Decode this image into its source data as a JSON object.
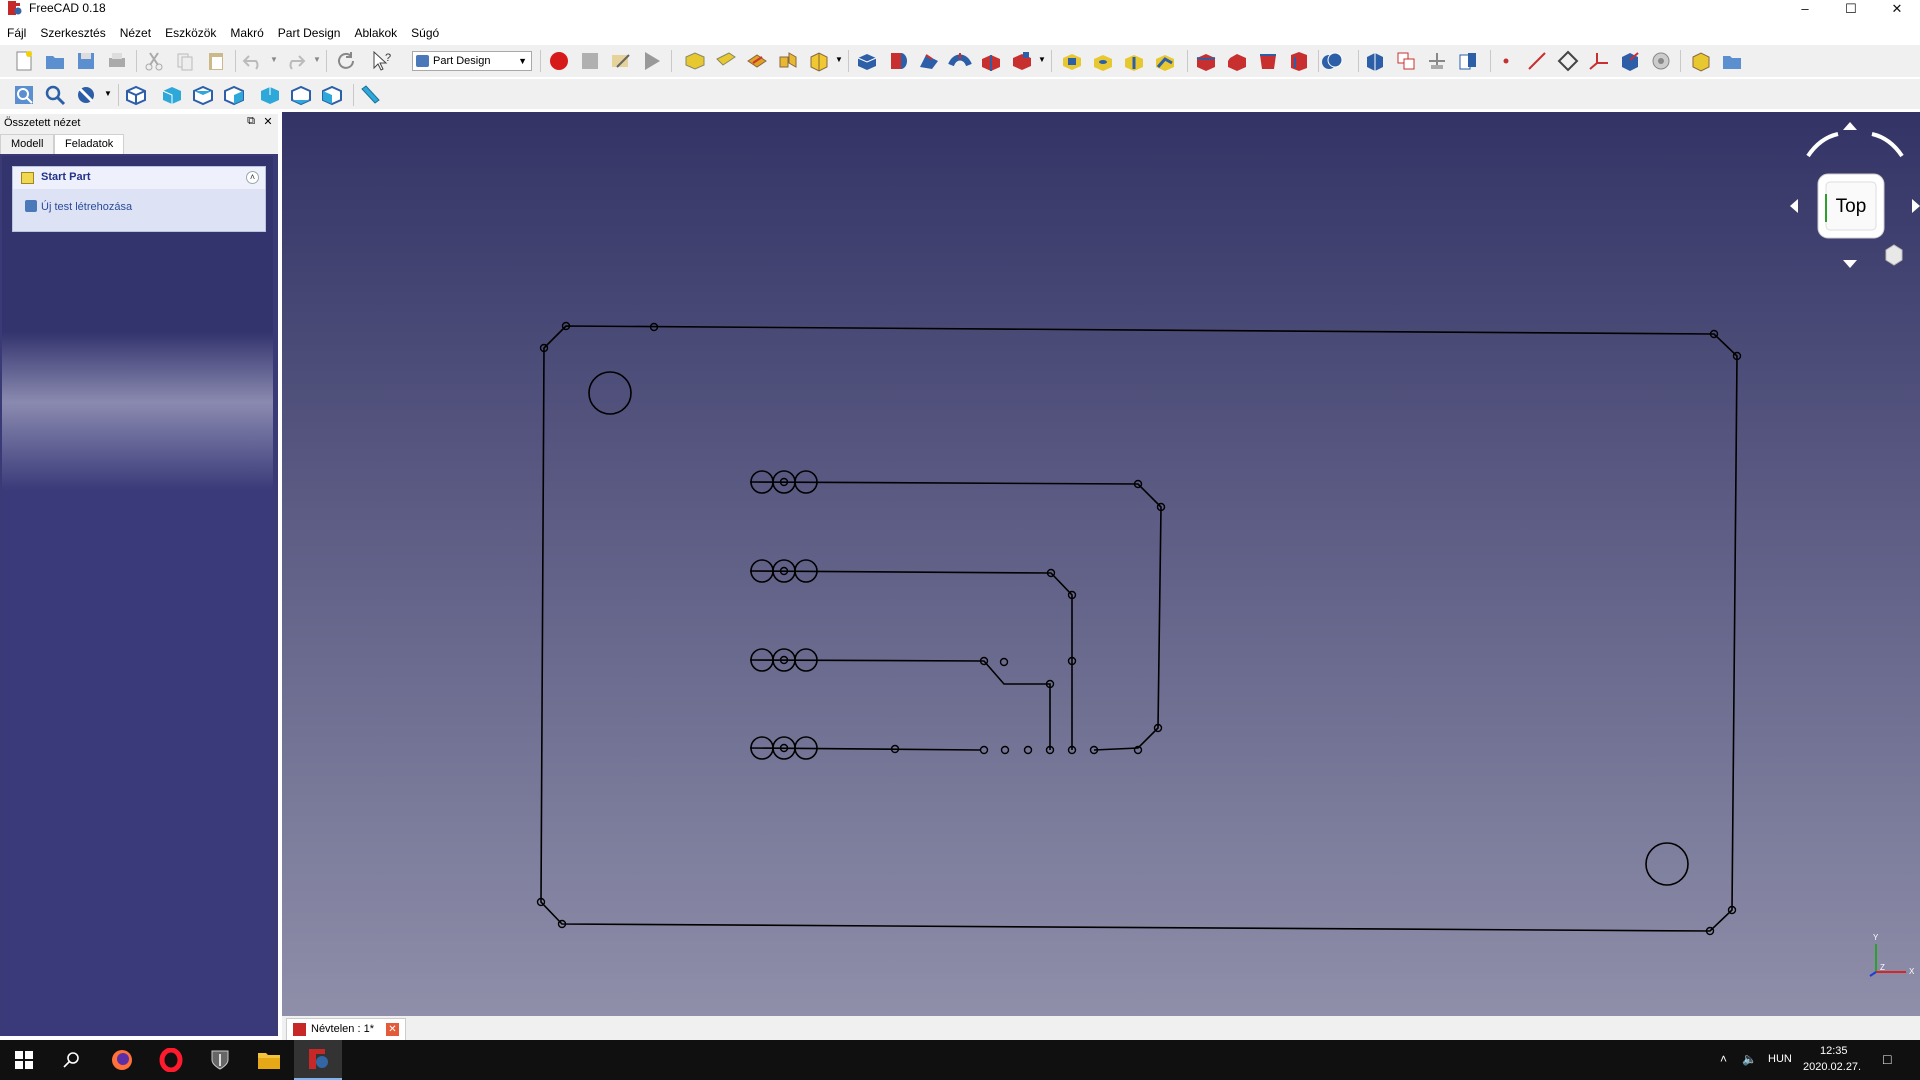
{
  "window": {
    "title": "FreeCAD 0.18"
  },
  "menu": [
    "Fájl",
    "Szerkesztés",
    "Nézet",
    "Eszközök",
    "Makró",
    "Part Design",
    "Ablakok",
    "Súgó"
  ],
  "toolbar": {
    "workbench": "Part Design"
  },
  "combo_view": {
    "title": "Összetett nézet",
    "tabs": [
      "Modell",
      "Feladatok"
    ],
    "active_tab": "Feladatok",
    "task_panel": {
      "title": "Start Part",
      "action": "Új test létrehozása"
    }
  },
  "view3d": {
    "navcube_face": "Top",
    "axis_labels": {
      "y": "Y",
      "x": "X",
      "z": "Z"
    }
  },
  "document_tab": {
    "label": "Névtelen : 1*"
  },
  "taskbar": {
    "language": "HUN",
    "time": "12:35",
    "date": "2020.02.27."
  },
  "colors": {
    "view_top": "#333366",
    "view_bottom": "#8f8faa",
    "sketch_line": "#000000",
    "record_button": "#d61a1a"
  }
}
